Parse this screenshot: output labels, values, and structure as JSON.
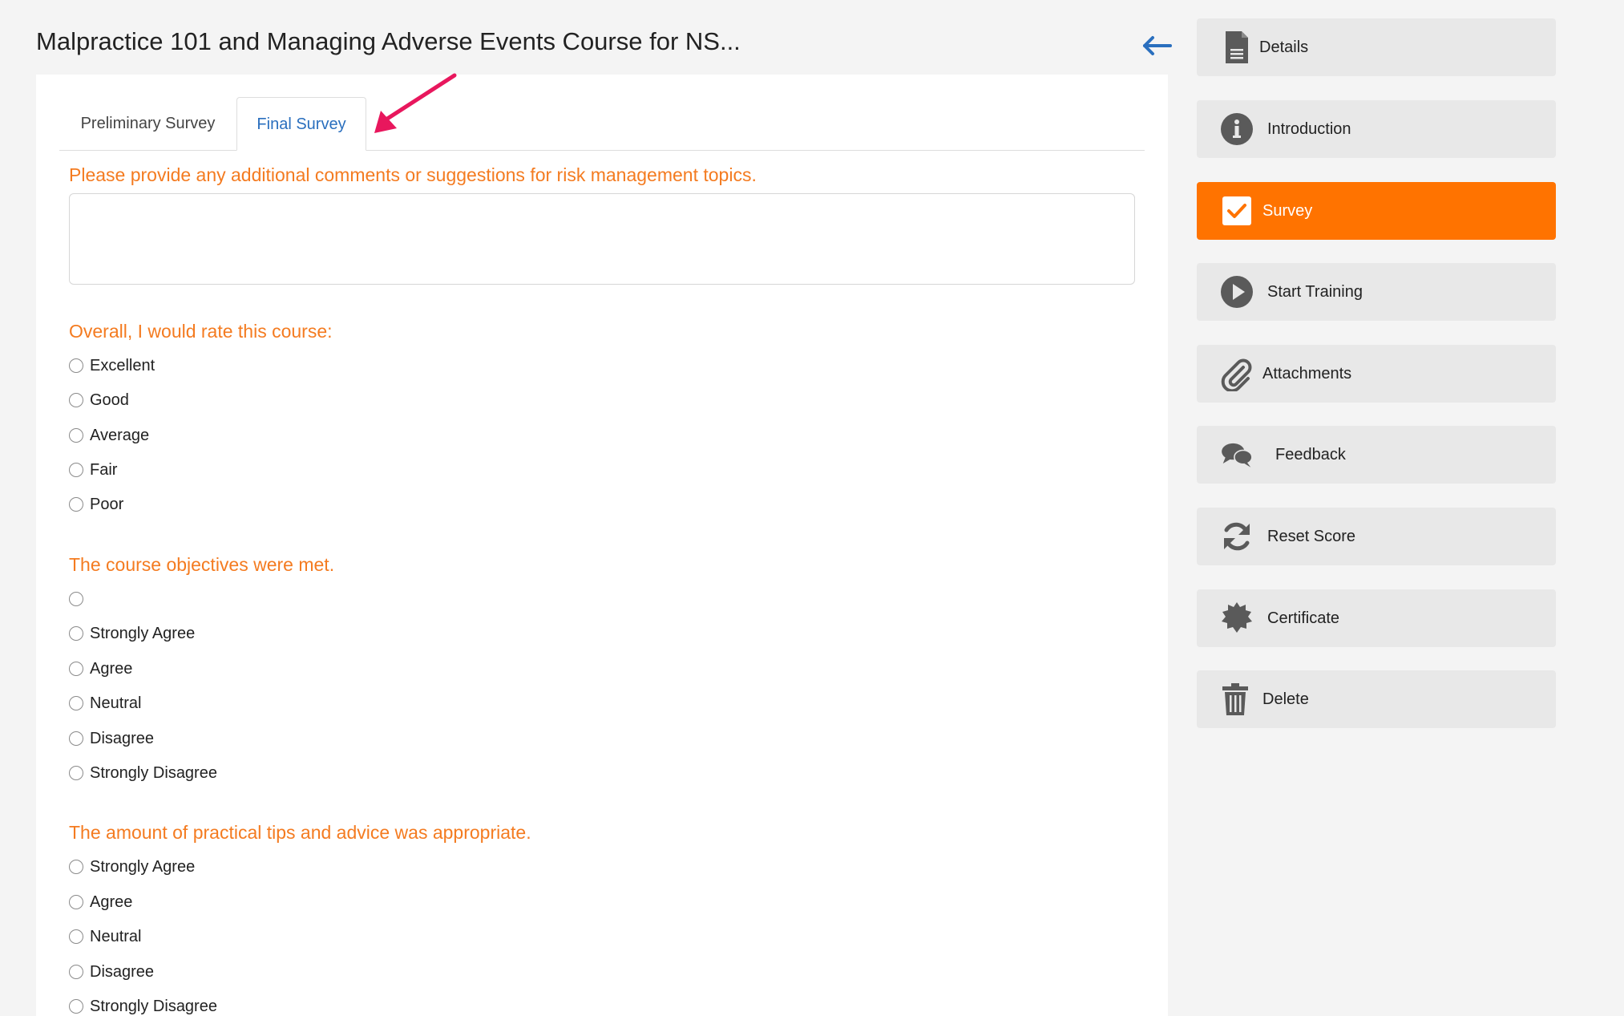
{
  "header": {
    "title": "Malpractice 101 and Managing Adverse Events Course for NS..."
  },
  "tabs": [
    {
      "label": "Preliminary Survey"
    },
    {
      "label": "Final Survey"
    }
  ],
  "survey": {
    "comments_question": "Please provide any additional comments or suggestions for risk management topics.",
    "comments_value": "",
    "q1": {
      "label": "Overall, I would rate this course:",
      "options": [
        "Excellent",
        "Good",
        "Average",
        "Fair",
        "Poor"
      ]
    },
    "q2": {
      "label": "The course objectives were met.",
      "options": [
        "",
        "Strongly Agree",
        "Agree",
        "Neutral",
        "Disagree",
        "Strongly Disagree"
      ]
    },
    "q3": {
      "label": "The amount of practical tips and advice was appropriate.",
      "options": [
        "Strongly Agree",
        "Agree",
        "Neutral",
        "Disagree",
        "Strongly Disagree"
      ]
    }
  },
  "sidebar": {
    "items": [
      {
        "label": "Details",
        "icon": "document-icon"
      },
      {
        "label": "Introduction",
        "icon": "info-icon"
      },
      {
        "label": "Survey",
        "icon": "checkbox-icon",
        "active": true
      },
      {
        "label": "Start Training",
        "icon": "play-icon"
      },
      {
        "label": "Attachments",
        "icon": "paperclip-icon"
      },
      {
        "label": "Feedback",
        "icon": "chat-bubbles-icon"
      },
      {
        "label": "Reset Score",
        "icon": "refresh-icon"
      },
      {
        "label": "Certificate",
        "icon": "certificate-icon"
      },
      {
        "label": "Delete",
        "icon": "trash-icon"
      }
    ]
  },
  "colors": {
    "accent": "#ff7300",
    "question_text": "#f47b20",
    "active_tab": "#2a6fbe",
    "icon_gray": "#5a5a5a",
    "annotation_arrow": "#e8175d"
  }
}
